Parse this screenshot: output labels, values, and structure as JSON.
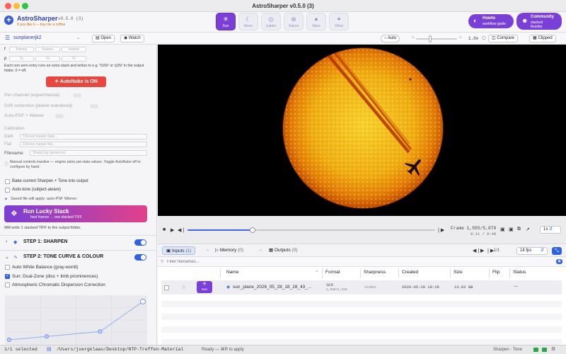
{
  "window": {
    "title": "AstroSharper v0.5.0 (3)"
  },
  "app": {
    "name": "AstroSharper",
    "version": "v0.5.0 (3)",
    "coffee_link": "If you like it — buy me a coffee"
  },
  "targets": [
    {
      "label": "Sun",
      "icon": "sun-icon",
      "glyph": "☀",
      "active": true
    },
    {
      "label": "Moon",
      "icon": "moon-icon",
      "glyph": "☾",
      "active": false
    },
    {
      "label": "Jupiter",
      "icon": "jupiter-icon",
      "glyph": "◎",
      "active": false
    },
    {
      "label": "Saturn",
      "icon": "saturn-icon",
      "glyph": "⊕",
      "active": false
    },
    {
      "label": "Mars",
      "icon": "mars-icon",
      "glyph": "●",
      "active": false
    },
    {
      "label": "Other",
      "icon": "other-icon",
      "glyph": "✦",
      "active": false
    }
  ],
  "howto": {
    "title": "Howto",
    "subtitle": "workflow guide",
    "glyph": "◐"
  },
  "community": {
    "title": "Community",
    "subtitle": "stacked thumbs",
    "glyph": "☻"
  },
  "subbar": {
    "project": "sunplanerjk2",
    "open_label": "Open",
    "watch_label": "Watch",
    "auto_label": "Auto",
    "zoom": "1.0x",
    "compare_label": "Compare",
    "clipped_label": "Clipped"
  },
  "sidebar": {
    "f_label": "f",
    "p_label": "p",
    "frames_placeholders": [
      "frames",
      "frames",
      "frames"
    ],
    "pct_placeholders": [
      "%",
      "%",
      "%"
    ],
    "help_text": "Each non-zero entry runs an extra stack and writes to e.g. 'f100/' or 'p25/' in the output folder. 0 = off.",
    "autonuke_label": "AutoNuke is ON",
    "per_channel": "Per-channel (experimental)",
    "drift": "Drift correction (planet wandered)",
    "auto_psf": "Auto-PSF + Wiener",
    "calibration": "Calibration",
    "dark_label": "Dark",
    "dark_placeholder": "Choose master dark...",
    "flat_label": "Flat",
    "flat_placeholder": "Choose master flat...",
    "filename_label": "Filename",
    "filename_value": "SharpCap (preserve)",
    "manual_note": "Manual controls inactive — engine picks per-data values. Toggle AutoNuke off to configure by hand.",
    "bake_label": "Bake current Sharpen + Tone into output",
    "autotone_label": "Auto-tone (subject-aware)",
    "saved_note": "Saved file will apply: auto-PSF Wiener.",
    "lucky_title": "Run Lucky Stack",
    "lucky_sub": "best frames → one stacked TIFF",
    "write_note": "Will write 1 stacked TIFF to the output folder.",
    "step1": "STEP 1: SHARPEN",
    "step2": "STEP 2: TONE CURVE & COLOUR",
    "awb_label": "Auto White Balance (gray-world)",
    "dualzone_label": "Sun: Dual-Zone (disc + limb prominences)",
    "adc_label": "Atmospheric Chromatic Dispersion Correction"
  },
  "viewer": {
    "frame_readout": "Frame 1,555/5,870",
    "time_readout": "0:11 / 0:40",
    "speed": "1x",
    "progress": 0.265
  },
  "tabs": {
    "inputs": "Inputs",
    "inputs_count": "(1)",
    "memory": "Memory",
    "memory_count": "(0)",
    "outputs": "Outputs",
    "outputs_count": "(0)",
    "page": "1/1",
    "fps": "18 fps"
  },
  "filter": {
    "placeholder": "Filter filenames..."
  },
  "table": {
    "columns": [
      "Name",
      "Format",
      "Sharpness",
      "Created",
      "Size",
      "Flip",
      "Status"
    ],
    "rows": [
      {
        "target": "Sun",
        "name": "sun_plane_2026_05_28_18_28_43_...",
        "format": "SER",
        "format_detail": "1,936×1,216",
        "sharpness": "video",
        "created": "2026-05-28 18:28",
        "size": "13.82 GB",
        "flip": "",
        "status": "—"
      }
    ]
  },
  "status": {
    "selection": "1/1 selected",
    "path": "/Users/joergklaas/Desktop/NTP-Treffen-Material",
    "ready": "Ready — ⌘R to apply",
    "mode": "Sharpen · Tone"
  },
  "colors": {
    "accent": "#7a3fd6",
    "blue": "#2f63e0",
    "danger": "#e8463f",
    "sun_core": "#f3b511",
    "sun_limb": "#d45a00"
  },
  "tone_curve": [
    [
      0,
      0.02
    ],
    [
      0.28,
      0.1
    ],
    [
      0.68,
      0.22
    ],
    [
      1,
      0.95
    ]
  ]
}
